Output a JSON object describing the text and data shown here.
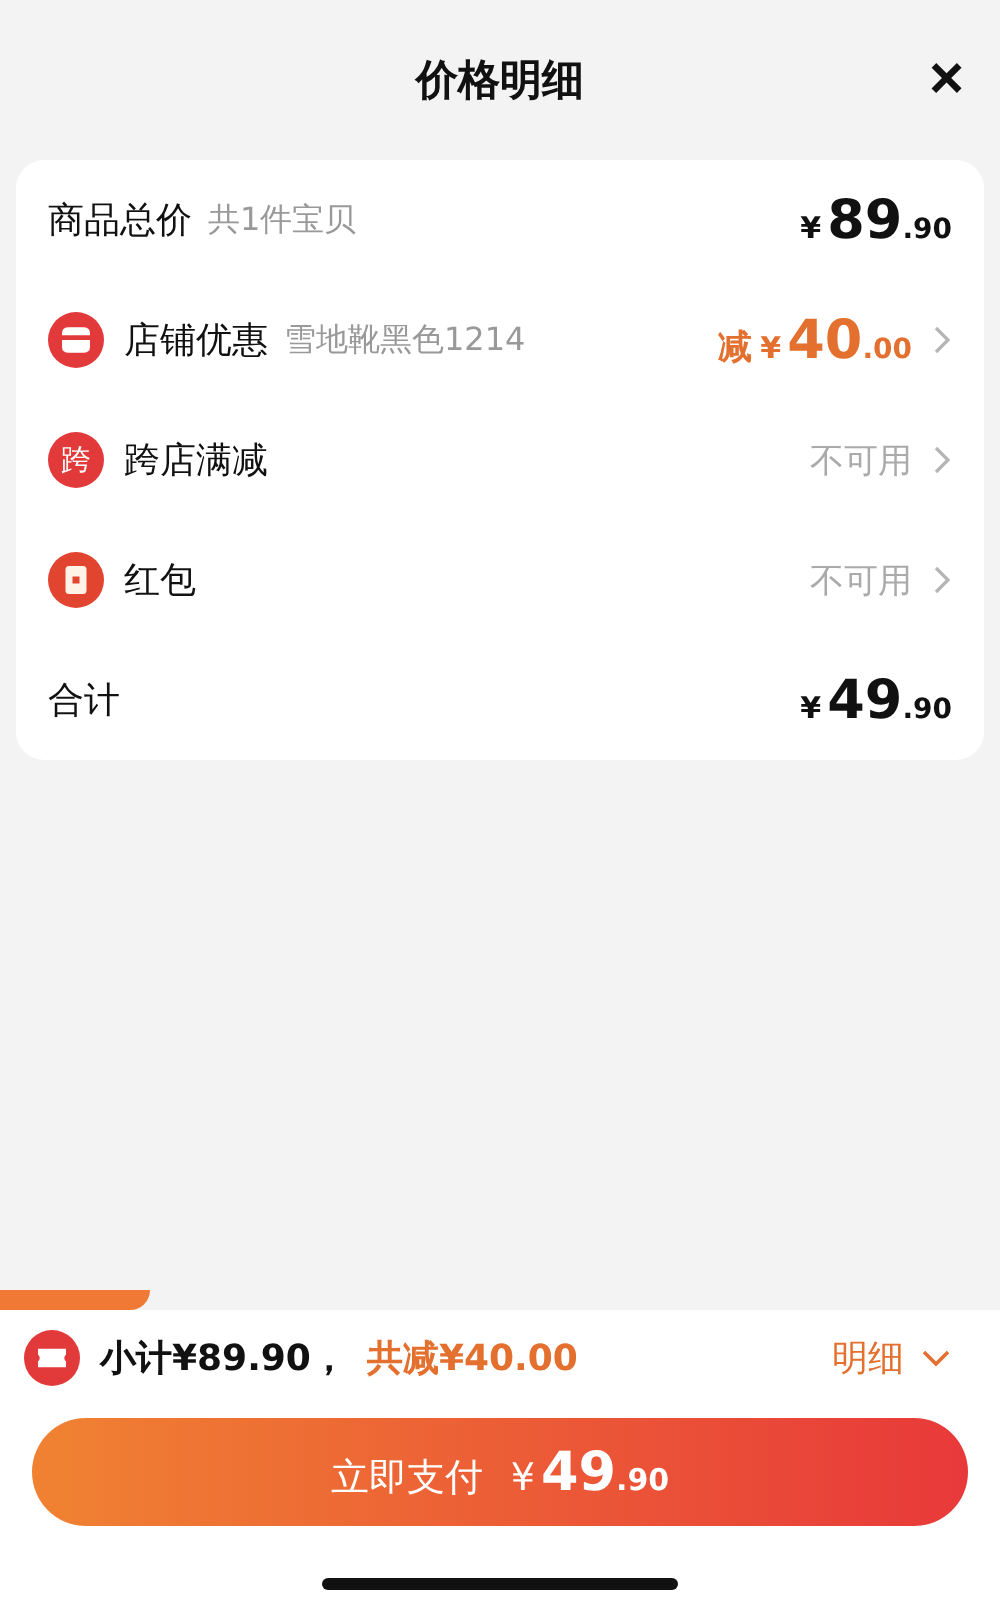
{
  "header": {
    "title": "价格明细",
    "close": "×"
  },
  "rows": [
    {
      "kind": "total",
      "label": "商品总价",
      "note": "共1件宝贝",
      "price": {
        "yen": "¥",
        "int": "89",
        "dec": ".90"
      }
    },
    {
      "kind": "discount",
      "label": "店铺优惠",
      "note": "雪地靴黑色1214",
      "prefix": "减",
      "price": {
        "yen": "¥",
        "int": "40",
        "dec": ".00"
      }
    },
    {
      "kind": "unavailable",
      "icon_text": "跨",
      "label": "跨店满减",
      "status": "不可用"
    },
    {
      "kind": "unavailable",
      "label": "红包",
      "status": "不可用"
    },
    {
      "kind": "sum",
      "label": "合计",
      "price": {
        "yen": "¥",
        "int": "49",
        "dec": ".90"
      }
    }
  ],
  "footer": {
    "subtotal": "小计¥89.90，",
    "reduction": "共减¥40.00",
    "details": "明细",
    "pay": {
      "label": "立即支付",
      "yen": "¥",
      "int": "49",
      "dec": ".90"
    }
  }
}
